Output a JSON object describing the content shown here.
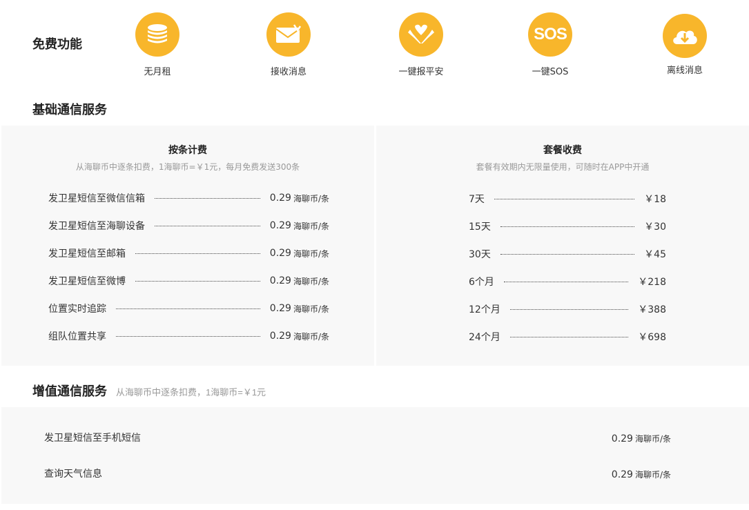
{
  "free_features": {
    "title": "免费功能",
    "items": [
      {
        "label": "无月租",
        "icon": "coins-stack-icon"
      },
      {
        "label": "接收消息",
        "icon": "envelope-icon"
      },
      {
        "label": "一键报平安",
        "icon": "hands-heart-icon"
      },
      {
        "label": "一键SOS",
        "icon": "sos-icon",
        "icon_text": "SOS"
      },
      {
        "label": "离线消息",
        "icon": "cloud-download-icon"
      }
    ]
  },
  "basic_service": {
    "title": "基础通信服务",
    "per_message": {
      "title": "按条计费",
      "subtitle": "从海聊币中逐条扣费，1海聊币=￥1元，每月免费发送300条",
      "rows": [
        {
          "name": "发卫星短信至微信信箱",
          "price": "0.29",
          "unit": "海聊币/条"
        },
        {
          "name": "发卫星短信至海聊设备",
          "price": "0.29",
          "unit": "海聊币/条"
        },
        {
          "name": "发卫星短信至邮箱",
          "price": "0.29",
          "unit": "海聊币/条"
        },
        {
          "name": "发卫星短信至微博",
          "price": "0.29",
          "unit": "海聊币/条"
        },
        {
          "name": "位置实时追踪",
          "price": "0.29",
          "unit": "海聊币/条"
        },
        {
          "name": "组队位置共享",
          "price": "0.29",
          "unit": "海聊币/条"
        }
      ]
    },
    "package": {
      "title": "套餐收费",
      "subtitle": "套餐有效期内无限量使用，可随时在APP中开通",
      "rows": [
        {
          "name": "7天",
          "price": "￥18"
        },
        {
          "name": "15天",
          "price": "￥30"
        },
        {
          "name": "30天",
          "price": "￥45"
        },
        {
          "name": "6个月",
          "price": "￥218"
        },
        {
          "name": "12个月",
          "price": "￥388"
        },
        {
          "name": "24个月",
          "price": "￥698"
        }
      ]
    }
  },
  "value_added": {
    "title": "增值通信服务",
    "note": "从海聊币中逐条扣费，1海聊币=￥1元",
    "rows": [
      {
        "name": "发卫星短信至手机短信",
        "price": "0.29",
        "unit": "海聊币/条"
      },
      {
        "name": "查询天气信息",
        "price": "0.29",
        "unit": "海聊币/条"
      }
    ]
  },
  "colors": {
    "accent": "#f8b62b",
    "panel_bg": "#f8f8f8"
  }
}
